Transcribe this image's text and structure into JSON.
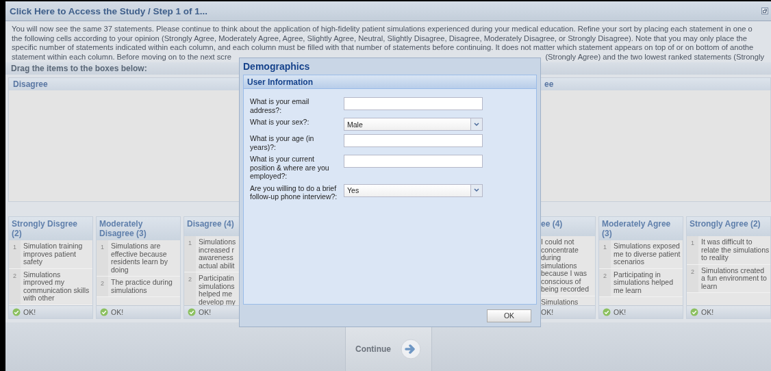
{
  "window": {
    "title": "Click Here to Access the Study / Step 1 of 1..."
  },
  "instructions": {
    "lines": [
      "You will now see the same 37 statements. Please continue to think about the application of high-fidelity patient simulations experienced during your medical education. Refine your sort by placing each statement in one o",
      "the following cells according to your opinion (Strongly Agree, Moderately Agree, Agree, Slightly Agree, Neutral, Slightly Disagree, Disagree, Moderately Disagree, or Strongly Disagree). Note that you may only place the",
      "specific number of statements indicated within each column, and each column must be filled with that number of statements before continuing. It does not matter which statement appears on top of or on bottom of anothe"
    ],
    "last_line_left": "statement within each column. Before moving on to the next scre",
    "last_line_right": "(Strongly Agree) and the two lowest ranked statements (Strongly"
  },
  "drag_hint": "Drag the items to the boxes below:",
  "drop_areas": [
    {
      "title": "Disagree"
    },
    {
      "title": "ee"
    }
  ],
  "columns_left": [
    {
      "title": "Strongly Disgree (2)",
      "items": [
        {
          "number": "1",
          "text": "Simulation training improves patient safety"
        },
        {
          "number": "2",
          "text": "Simulations improved my communication skills with other"
        }
      ],
      "status": "OK!"
    },
    {
      "title": "Moderately Disagree (3)",
      "items": [
        {
          "number": "1",
          "text": "Simulations are effective because residents learn by doing"
        },
        {
          "number": "2",
          "text": "The practice during simulations"
        }
      ],
      "status": "OK!"
    },
    {
      "title": "Disagree (4)",
      "items": [
        {
          "number": "1",
          "text": "Simulations\nincreased r\nawareness\nactual abilit"
        },
        {
          "number": "2",
          "text": "Participatin\nsimulations\nhelped me\ndevelop my"
        }
      ],
      "status": "OK!"
    }
  ],
  "columns_right": [
    {
      "title": "ee (4)",
      "items": [
        {
          "text": "I could not concentrate during simulations because I was conscious of being recorded"
        },
        {
          "text": "Simulations"
        }
      ],
      "status": "OK!"
    },
    {
      "title": "Moderately Agree (3)",
      "items": [
        {
          "number": "1",
          "text": "Simulations exposed me to diverse patient scenarios"
        },
        {
          "number": "2",
          "text": "Participating in simulations helped me learn"
        }
      ],
      "status": "OK!"
    },
    {
      "title": "Strongly Agree (2)",
      "items": [
        {
          "number": "1",
          "text": "It was difficult to relate the simulations to reality"
        },
        {
          "number": "2",
          "text": "Simulations created a fun environment to learn"
        }
      ],
      "status": "OK!"
    }
  ],
  "continue_button": {
    "label": "Continue"
  },
  "dialog": {
    "title": "Demographics",
    "section": "User Information",
    "fields": [
      {
        "label": "What is your email address?:",
        "kind": "text"
      },
      {
        "label": "What is your sex?:",
        "kind": "select",
        "value": "Male"
      },
      {
        "label": "What is your age (in years)?:",
        "kind": "text"
      },
      {
        "label": "What is your current position & where are you employed?:",
        "kind": "text"
      },
      {
        "label": "Are you willing to do a brief follow-up phone interview?:",
        "kind": "select",
        "value": "Yes"
      }
    ],
    "ok_button": "OK"
  }
}
